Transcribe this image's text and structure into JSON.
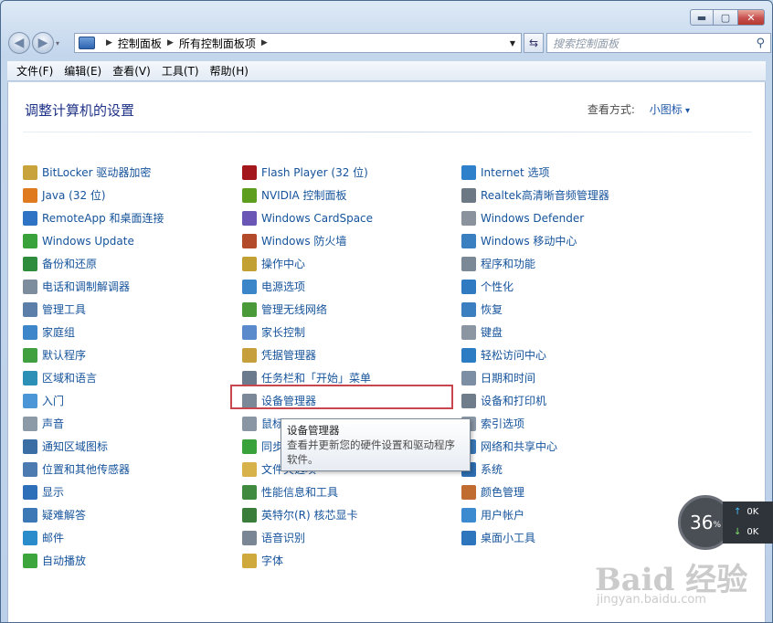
{
  "window": {
    "controls": {
      "minimize": "▬",
      "maximize": "▢",
      "close": "✕"
    }
  },
  "nav": {
    "back": "◀",
    "forward": "▶",
    "breadcrumb": [
      "控制面板",
      "所有控制面板项"
    ],
    "search_placeholder": "搜索控制面板"
  },
  "menu": [
    "文件(F)",
    "编辑(E)",
    "查看(V)",
    "工具(T)",
    "帮助(H)"
  ],
  "header": {
    "title": "调整计算机的设置",
    "view_by_label": "查看方式:",
    "view_by_value": "小图标"
  },
  "columns": [
    [
      {
        "label": "BitLocker 驱动器加密",
        "icon": "bitlocker-icon",
        "color": "#c8a23a"
      },
      {
        "label": "Java (32 位)",
        "icon": "java-icon",
        "color": "#e07a1f"
      },
      {
        "label": "RemoteApp 和桌面连接",
        "icon": "remoteapp-icon",
        "color": "#2f74c4"
      },
      {
        "label": "Windows Update",
        "icon": "windows-update-icon",
        "color": "#3aa23a"
      },
      {
        "label": "备份和还原",
        "icon": "backup-icon",
        "color": "#2e8d3c"
      },
      {
        "label": "电话和调制解调器",
        "icon": "phone-modem-icon",
        "color": "#7d8d9e"
      },
      {
        "label": "管理工具",
        "icon": "admin-tools-icon",
        "color": "#5b7fa8"
      },
      {
        "label": "家庭组",
        "icon": "homegroup-icon",
        "color": "#3d86c9"
      },
      {
        "label": "默认程序",
        "icon": "default-programs-icon",
        "color": "#40a040"
      },
      {
        "label": "区域和语言",
        "icon": "region-language-icon",
        "color": "#2c8fb5"
      },
      {
        "label": "入门",
        "icon": "getting-started-icon",
        "color": "#4a96d6"
      },
      {
        "label": "声音",
        "icon": "sound-icon",
        "color": "#8c99a6"
      },
      {
        "label": "通知区域图标",
        "icon": "notification-icon",
        "color": "#3a6ea5"
      },
      {
        "label": "位置和其他传感器",
        "icon": "sensor-icon",
        "color": "#4b7bb1"
      },
      {
        "label": "显示",
        "icon": "display-icon",
        "color": "#2d6fb8"
      },
      {
        "label": "疑难解答",
        "icon": "troubleshoot-icon",
        "color": "#3b78b5"
      },
      {
        "label": "邮件",
        "icon": "mail-icon",
        "color": "#2b8ccc"
      },
      {
        "label": "自动播放",
        "icon": "autoplay-icon",
        "color": "#3ca53c"
      }
    ],
    [
      {
        "label": "Flash Player (32 位)",
        "icon": "flash-icon",
        "color": "#a3171c"
      },
      {
        "label": "NVIDIA 控制面板",
        "icon": "nvidia-icon",
        "color": "#5e9e1e"
      },
      {
        "label": "Windows CardSpace",
        "icon": "cardspace-icon",
        "color": "#6a56b5"
      },
      {
        "label": "Windows 防火墙",
        "icon": "firewall-icon",
        "color": "#b34a2a"
      },
      {
        "label": "操作中心",
        "icon": "action-center-icon",
        "color": "#c2a034"
      },
      {
        "label": "电源选项",
        "icon": "power-icon",
        "color": "#3a86c8"
      },
      {
        "label": "管理无线网络",
        "icon": "wireless-icon",
        "color": "#4a9a3a"
      },
      {
        "label": "家长控制",
        "icon": "parental-control-icon",
        "color": "#5a8acb"
      },
      {
        "label": "凭据管理器",
        "icon": "credential-icon",
        "color": "#c7a03e"
      },
      {
        "label": "任务栏和「开始」菜单",
        "icon": "taskbar-icon",
        "color": "#6b7a8c"
      },
      {
        "label": "设备管理器",
        "icon": "device-manager-icon",
        "color": "#7a8898"
      },
      {
        "label": "鼠标",
        "icon": "mouse-icon",
        "color": "#8a96a3"
      },
      {
        "label": "同步中心",
        "icon": "sync-icon",
        "color": "#3aa23a"
      },
      {
        "label": "文件夹选项",
        "icon": "folder-icon",
        "color": "#d7b14a"
      },
      {
        "label": "性能信息和工具",
        "icon": "performance-icon",
        "color": "#3f8a3f"
      },
      {
        "label": "英特尔(R) 核芯显卡",
        "icon": "intel-icon",
        "color": "#3a7d3a"
      },
      {
        "label": "语音识别",
        "icon": "speech-icon",
        "color": "#7a8694"
      },
      {
        "label": "字体",
        "icon": "font-icon",
        "color": "#d0a93c"
      }
    ],
    [
      {
        "label": "Internet 选项",
        "icon": "internet-icon",
        "color": "#2d80c9"
      },
      {
        "label": "Realtek高清晰音频管理器",
        "icon": "realtek-icon",
        "color": "#6c7884"
      },
      {
        "label": "Windows Defender",
        "icon": "defender-icon",
        "color": "#8a939d"
      },
      {
        "label": "Windows 移动中心",
        "icon": "mobility-icon",
        "color": "#3a7fbf"
      },
      {
        "label": "程序和功能",
        "icon": "programs-icon",
        "color": "#7b8896"
      },
      {
        "label": "个性化",
        "icon": "personalize-icon",
        "color": "#2f7ac1"
      },
      {
        "label": "恢复",
        "icon": "recovery-icon",
        "color": "#3c7fc0"
      },
      {
        "label": "键盘",
        "icon": "keyboard-icon",
        "color": "#8b96a2"
      },
      {
        "label": "轻松访问中心",
        "icon": "ease-of-access-icon",
        "color": "#2c7cc3"
      },
      {
        "label": "日期和时间",
        "icon": "datetime-icon",
        "color": "#7b8ea4"
      },
      {
        "label": "设备和打印机",
        "icon": "printer-icon",
        "color": "#6f7c8a"
      },
      {
        "label": "索引选项",
        "icon": "index-icon",
        "color": "#8a97a5"
      },
      {
        "label": "网络和共享中心",
        "icon": "network-icon",
        "color": "#3a78b8"
      },
      {
        "label": "系统",
        "icon": "system-icon",
        "color": "#2e6fb3"
      },
      {
        "label": "颜色管理",
        "icon": "color-management-icon",
        "color": "#c06b2f"
      },
      {
        "label": "用户帐户",
        "icon": "user-accounts-icon",
        "color": "#3c8bd0"
      },
      {
        "label": "桌面小工具",
        "icon": "gadgets-icon",
        "color": "#2d75bd"
      }
    ]
  ],
  "tooltip": {
    "title": "设备管理器",
    "body": "查看并更新您的硬件设置和驱动程序软件。"
  },
  "speed_widget": {
    "percent": "36",
    "unit": "%",
    "up": "0K",
    "down": "0K"
  },
  "watermark": {
    "main": "Baid 经验",
    "sub": "jingyan.baidu.com"
  }
}
